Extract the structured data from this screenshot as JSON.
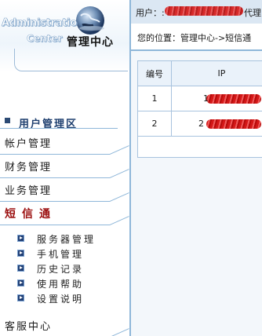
{
  "logo": {
    "en_line1": "Administratio",
    "en_line2": "Center",
    "cn_title": "管理中心"
  },
  "sidebar": {
    "section_title": "用户管理区",
    "categories": [
      {
        "label": "帐户管理"
      },
      {
        "label": "财务管理"
      },
      {
        "label": "业务管理"
      },
      {
        "label": "短信通"
      }
    ],
    "subitems": [
      {
        "label": "服务器管理"
      },
      {
        "label": "手机管理"
      },
      {
        "label": "历史记录"
      },
      {
        "label": "使用帮助"
      },
      {
        "label": "设置说明"
      }
    ],
    "bottom": {
      "label": "客服中心"
    }
  },
  "topbar": {
    "user_prefix": "用户：:",
    "role_suffix": "代理"
  },
  "location": {
    "text": "您的位置：管理中心->短信通"
  },
  "table": {
    "headers": [
      "编号",
      "IP"
    ],
    "rows": [
      {
        "id": "1",
        "ip_prefix": "1"
      },
      {
        "id": "2",
        "ip_prefix": "2"
      }
    ]
  },
  "colors": {
    "accent_blue": "#8fb7d9",
    "active_red": "#9b0f0f",
    "redaction_red": "#d51919"
  }
}
